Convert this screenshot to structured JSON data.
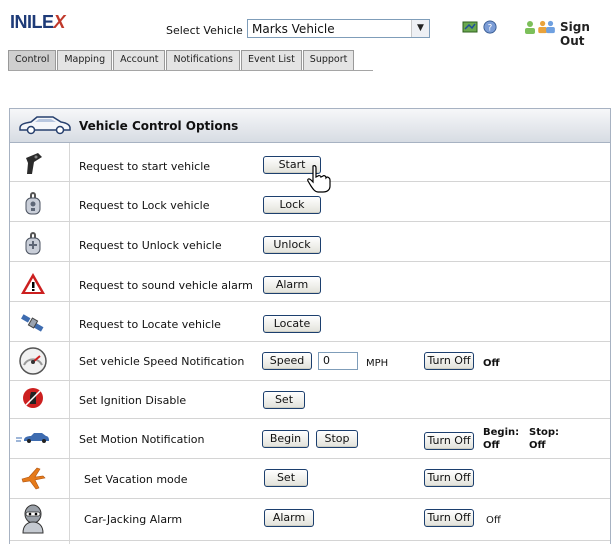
{
  "header": {
    "logo_main": "INILE",
    "logo_x": "X",
    "select_label": "Select Vehicle",
    "selected_vehicle": "Marks Vehicle",
    "sign_out": "Sign Out"
  },
  "tabs": [
    {
      "label": "Control",
      "active": true
    },
    {
      "label": "Mapping"
    },
    {
      "label": "Account"
    },
    {
      "label": "Notifications"
    },
    {
      "label": "Event List"
    },
    {
      "label": "Support"
    }
  ],
  "panel": {
    "title": "Vehicle Control Options",
    "rows": [
      {
        "label": "Request to start vehicle",
        "icon": "key-remote-icon",
        "button": "Start"
      },
      {
        "label": "Request to Lock vehicle",
        "icon": "lock-fob-icon",
        "button": "Lock"
      },
      {
        "label": "Request to Unlock vehicle",
        "icon": "unlock-fob-icon",
        "button": "Unlock"
      },
      {
        "label": "Request to sound vehicle alarm",
        "icon": "warning-triangle-icon",
        "button": "Alarm"
      },
      {
        "label": "Request to Locate vehicle",
        "icon": "satellite-icon",
        "button": "Locate"
      },
      {
        "label": "Set vehicle Speed Notification",
        "icon": "speedometer-icon",
        "button": "Speed",
        "input_value": "0",
        "unit": "MPH",
        "turn_off": "Turn Off",
        "status": "Off"
      },
      {
        "label": "Set Ignition Disable",
        "icon": "ignition-disable-icon",
        "button": "Set"
      },
      {
        "label": "Set Motion Notification",
        "icon": "car-motion-icon",
        "button": "Begin",
        "button2": "Stop",
        "turn_off": "Turn Off",
        "begin_label": "Begin:",
        "stop_label": "Stop:",
        "begin_status": "Off",
        "stop_status": "Off"
      },
      {
        "label": "Set Vacation mode",
        "icon": "airplane-icon",
        "button": "Set",
        "turn_off": "Turn Off"
      },
      {
        "label": "Car-Jacking Alarm",
        "icon": "masked-person-icon",
        "button": "Alarm",
        "turn_off": "Turn Off",
        "status": "Off"
      }
    ]
  },
  "colors": {
    "logo_blue": "#1e3b78",
    "logo_red": "#c0392b",
    "button_border": "#1c3f6e",
    "alarm_red": "#cc1f1f"
  }
}
